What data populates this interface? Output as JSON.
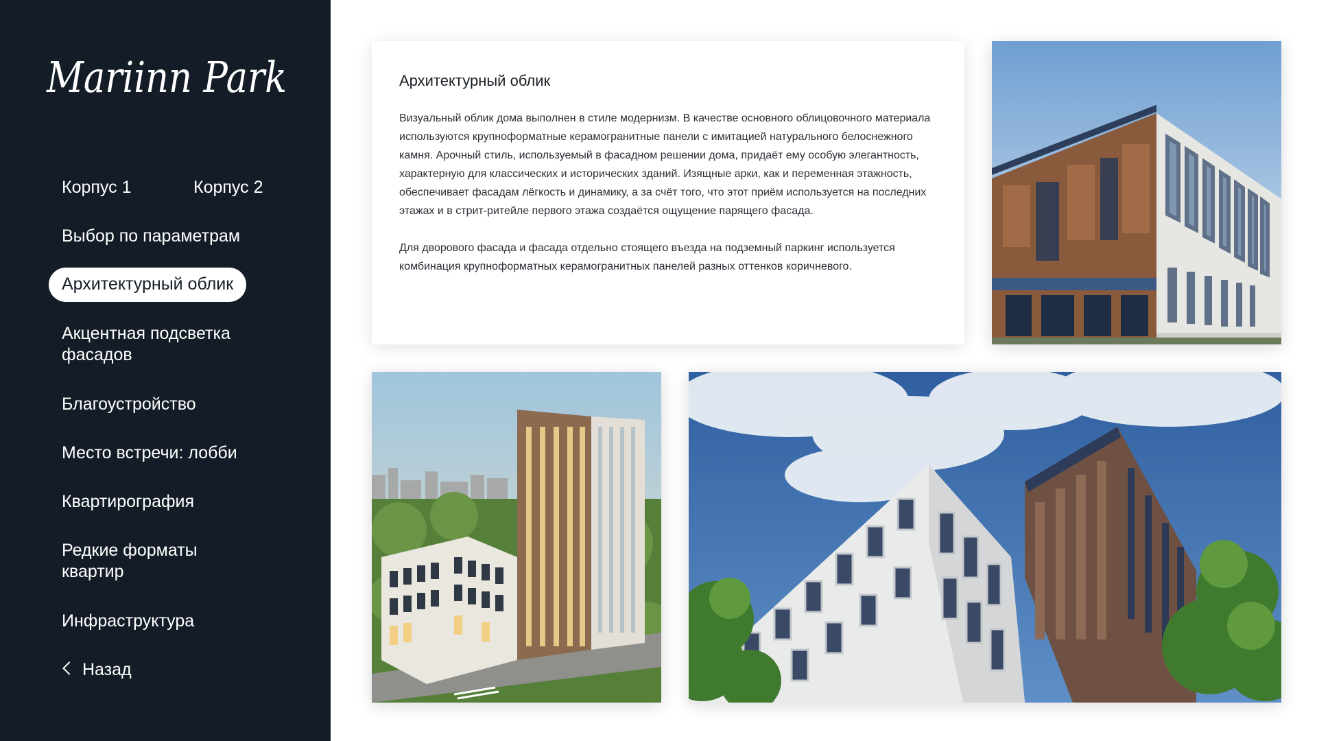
{
  "brand": {
    "logo_text": "Mariinn Park"
  },
  "nav": {
    "korpus1": "Корпус 1",
    "korpus2": "Корпус 2",
    "items": [
      "Выбор по параметрам",
      "Архитектурный облик",
      "Акцентная подсветка фасадов",
      "Благоустройство",
      "Место встречи: лобби",
      "Квартирография",
      "Редкие форматы квартир",
      "Инфраструктура"
    ],
    "active_index": 1,
    "back_label": "Назад"
  },
  "content": {
    "title": "Архитектурный облик",
    "paragraph1": "Визуальный облик дома выполнен в стиле модернизм. В качестве основного облицовочного материала используются крупноформатные керамогранитные панели с имитацией натурального белоснежного камня. Арочный стиль, используемый в фасадном решении дома, придаёт ему особую элегантность, характерную для классических и исторических зданий. Изящные арки, как и переменная этажность, обеспечивает фасадам лёгкость и динамику, а за счёт того, что этот приём используется на последних этажах и в стрит-ритейле первого этажа создаётся ощущение парящего фасада.",
    "paragraph2": "Для дворового фасада и фасада отдельно стоящего въезда на подземный паркинг используется комбинация крупноформатных керамогранитных панелей разных оттенков коричневого."
  },
  "images": [
    {
      "name": "facade-corner-photo"
    },
    {
      "name": "tower-aerial-photo"
    },
    {
      "name": "facade-low-angle-photo"
    }
  ],
  "colors": {
    "sidebar_bg": "#141d27",
    "text_light": "#ffffff",
    "text_dark": "#1a1f25",
    "facade_brown": "#8a5a3c",
    "facade_white": "#e9e9e6",
    "sky_blue": "#8db3d6",
    "greenery": "#4f7a35"
  }
}
